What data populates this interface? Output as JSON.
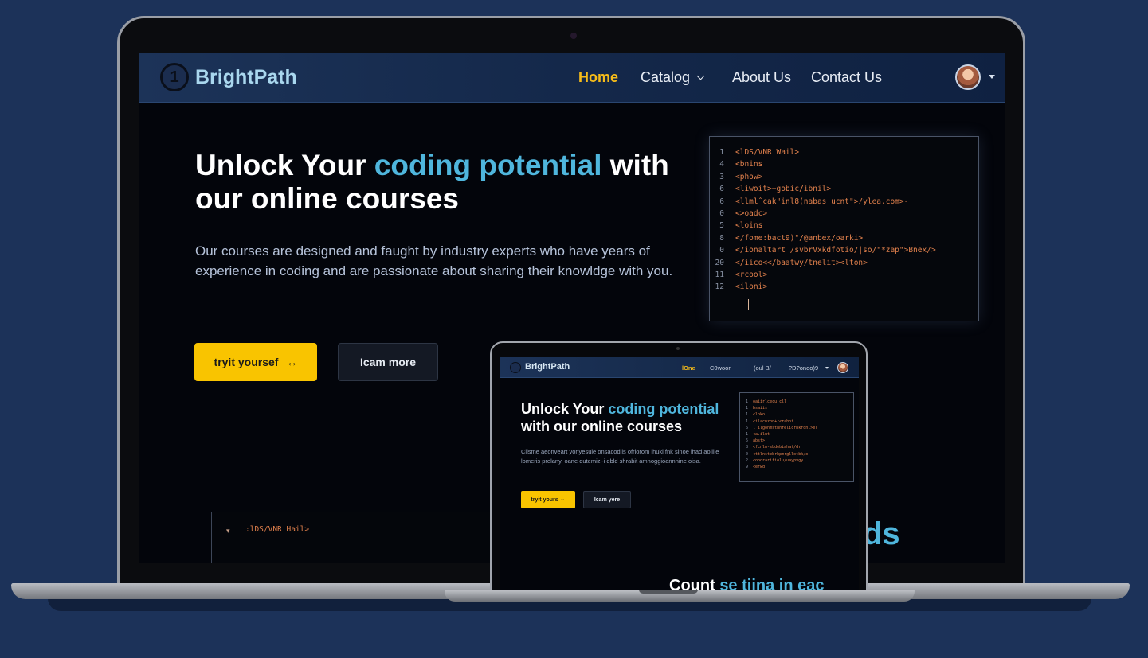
{
  "brand": {
    "name": "BrightPath",
    "logo_glyph": "1",
    "logo_icon": "number-one-badge-icon"
  },
  "nav": {
    "items": [
      {
        "label": "Home",
        "active": true
      },
      {
        "label": "Catalog",
        "active": false,
        "dropdown": true
      },
      {
        "label": "About Us",
        "active": false
      },
      {
        "label": "Contact Us",
        "active": false
      }
    ],
    "avatar_icon": "user-avatar-icon",
    "account_menu_icon": "caret-down-icon"
  },
  "hero": {
    "title_pre": "Unlock Your ",
    "title_accent": "coding potential",
    "title_post": " with our online courses",
    "description": "Our courses are designed and faught by industry experts who have years of experience in coding and are passionate about sharing their knowldge with you.",
    "primary_button": "tryit yoursef",
    "primary_button_icon": "↔",
    "secondary_button": "Icam more"
  },
  "code_sample": {
    "lines": [
      {
        "n": "1",
        "code": "<lDS/VNR Wail>"
      },
      {
        "n": "4",
        "code": "<bnins"
      },
      {
        "n": "3",
        "code": "<phow>"
      },
      {
        "n": "6",
        "code": "<liwoit>+gobic/ibnil>"
      },
      {
        "n": "6",
        "code": "<llmlˆcak\"inl8(nabas ucnt\">/ylea.com>-"
      },
      {
        "n": "0",
        "code": "<>oadc>"
      },
      {
        "n": "5",
        "code": "<loins"
      },
      {
        "n": "8",
        "code": "</fome:bact9)\"/@anbex/oarki>"
      },
      {
        "n": "0",
        "code": "</ionaltart /svbrVxkdfotio/|so/\"*zap\">Bnex/>"
      },
      {
        "n": "20",
        "code": "</iico<</baatwy/tnelit><lton>"
      },
      {
        "n": "11",
        "code": "<rcool>"
      },
      {
        "n": "12",
        "code": "<iloni>"
      }
    ],
    "lower_line": ":lDS/VNR Hail>",
    "lower_marker": "▾"
  },
  "lower_heading_fragment": "ds",
  "small_preview": {
    "brand": "BrightPath",
    "nav": [
      "lOne",
      "C0woor",
      "(oul B/",
      "?D?onoo)9"
    ],
    "title_pre": "Unlock Your ",
    "title_accent": "coding potential",
    "title_post": " with our online courses",
    "description": "Clisme aeonveart yorlyesuie onsacodils ofrlorom lhuki fnk sinoe lhad aoilile lomeris prelany, oane dutemizi-i qbld shrabit amnoggioannnine oisa.",
    "primary_button": "tryit yours ⇔",
    "secondary_button": "Icam yere",
    "code_lines": [
      {
        "n": "1",
        "code": "oaiirlcecu cll"
      },
      {
        "n": "1",
        "code": "bsaiis"
      },
      {
        "n": "1",
        "code": "<loko"
      },
      {
        "n": "1",
        "code": "<ilacnzon+r<rahoi"
      },
      {
        "n": "6",
        "code": "l ilgonmstnhrelicrnkronl>el"
      },
      {
        "n": "1",
        "code": "<a.ilut"
      },
      {
        "n": "5",
        "code": "abst>"
      },
      {
        "n": "8",
        "code": "<fcnlm-sbdebiahat/dr"
      },
      {
        "n": "0",
        "code": "<ttlnstebrbpmrgllotbk/o"
      },
      {
        "n": "2",
        "code": "<oporarifiolu/uaypvgy"
      },
      {
        "n": "9",
        "code": "<erwd"
      }
    ],
    "bottom_pre": "Count ",
    "bottom_accent": "se tiina in eac "
  }
}
